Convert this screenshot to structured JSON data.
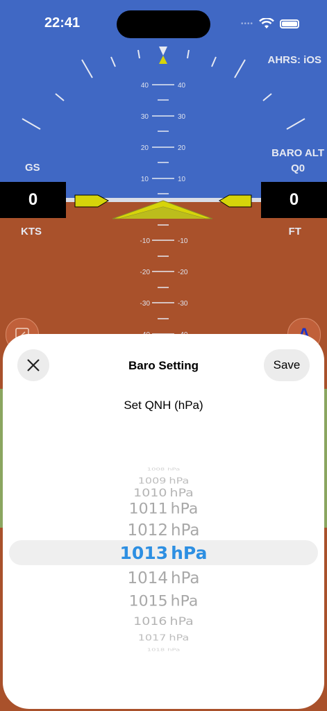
{
  "status_bar": {
    "time": "22:41"
  },
  "instruments": {
    "ahrs": "AHRS: iOS",
    "gs_label": "GS",
    "gs_value": "0",
    "speed_unit": "KTS",
    "baro_alt_label": "BARO ALT",
    "baro_alt_sub": "Q0",
    "alt_value": "0",
    "alt_unit": "FT",
    "pitch_labels": [
      "40",
      "30",
      "20",
      "10",
      "-10",
      "-20",
      "-30",
      "-40"
    ],
    "right_button_label": "A"
  },
  "sheet": {
    "title": "Baro Setting",
    "save_label": "Save",
    "set_label": "Set QNH (hPa)",
    "picker": {
      "rows": [
        {
          "number": "1008",
          "unit": "hPa"
        },
        {
          "number": "1009",
          "unit": "hPa"
        },
        {
          "number": "1010",
          "unit": "hPa"
        },
        {
          "number": "1011",
          "unit": "hPa"
        },
        {
          "number": "1012",
          "unit": "hPa"
        },
        {
          "number": "1013",
          "unit": "hPa"
        },
        {
          "number": "1014",
          "unit": "hPa"
        },
        {
          "number": "1015",
          "unit": "hPa"
        },
        {
          "number": "1016",
          "unit": "hPa"
        },
        {
          "number": "1017",
          "unit": "hPa"
        },
        {
          "number": "1018",
          "unit": "hPa"
        }
      ],
      "selected": "1013"
    }
  }
}
